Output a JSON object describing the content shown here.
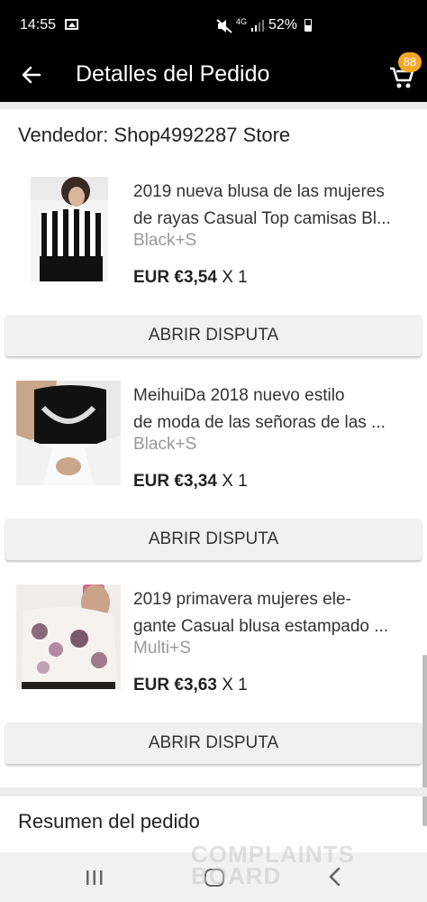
{
  "status_bar": {
    "time": "14:55",
    "network": "4G",
    "battery": "52%"
  },
  "app_bar": {
    "title": "Detalles del Pedido",
    "cart_count": "88"
  },
  "seller": {
    "label": "Vendedor: Shop4992287 Store"
  },
  "items": [
    {
      "title_line1": "2019 nueva blusa de las mujeres",
      "title_line2": "de rayas Casual Top camisas Bl...",
      "variant": "Black+S",
      "price": "EUR €3,54",
      "qty": " X 1",
      "button": "ABRIR DISPUTA"
    },
    {
      "title_line1": "MeihuiDa 2018 nuevo estilo",
      "title_line2": "de moda de las señoras de las ...",
      "variant": "Black+S",
      "price": "EUR €3,34",
      "qty": " X 1",
      "button": "ABRIR DISPUTA"
    },
    {
      "title_line1": "2019 primavera mujeres ele-",
      "title_line2": "gante Casual blusa estampado ...",
      "variant": "Multi+S",
      "price": "EUR €3,63",
      "qty": " X 1",
      "button": "ABRIR DISPUTA"
    }
  ],
  "summary": {
    "label": "Resumen del pedido"
  },
  "watermark": {
    "line1": "COMPLAINTS",
    "line2": "BOARD"
  },
  "colors": {
    "header_bg": "#000000",
    "badge": "#f5a623",
    "button_bg": "#f1f1f1"
  }
}
